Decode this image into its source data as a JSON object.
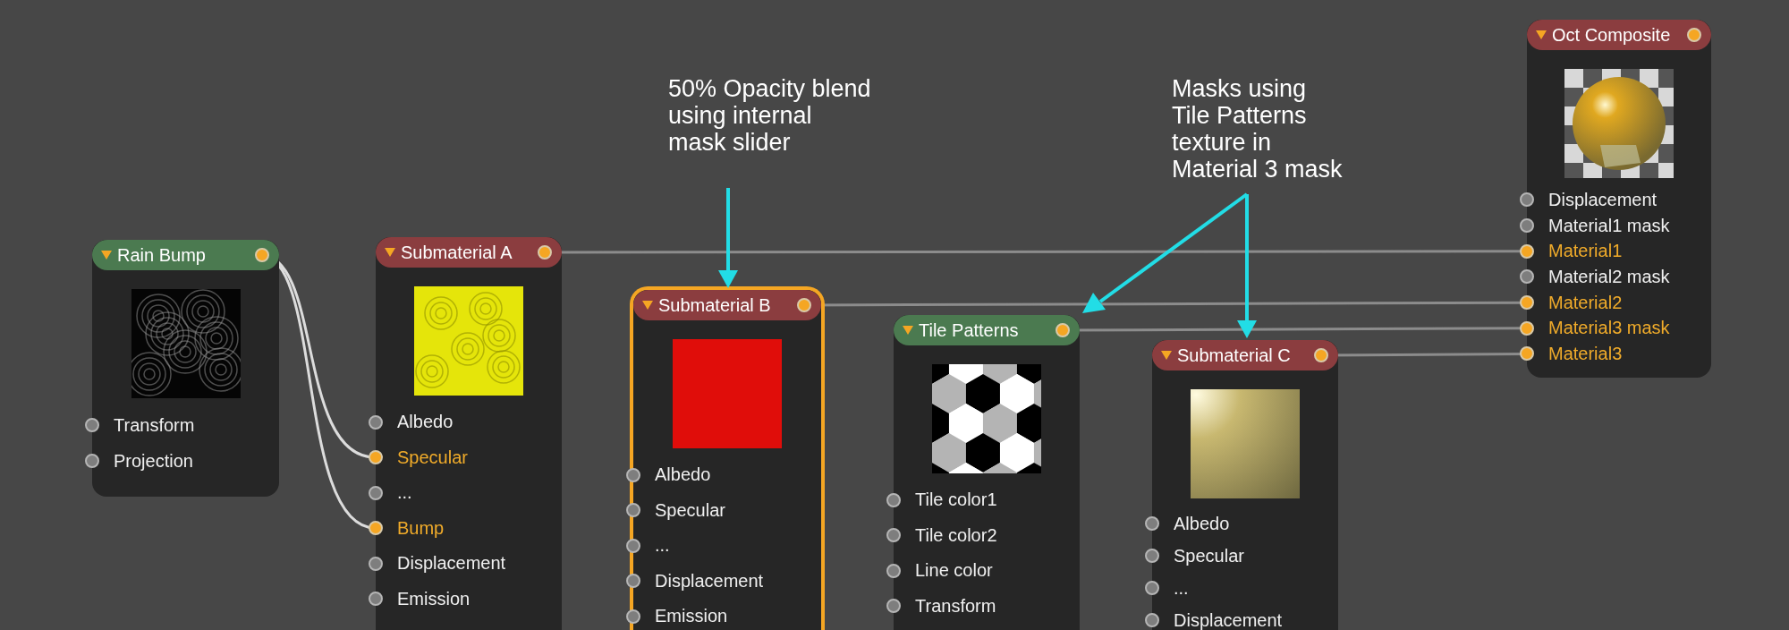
{
  "nodes": [
    {
      "title": "Rain Bump",
      "kind": "texture",
      "selected": false,
      "ports": [
        {
          "label": "Transform",
          "connected": false
        },
        {
          "label": "Projection",
          "connected": false
        }
      ]
    },
    {
      "title": "Submaterial A",
      "kind": "material",
      "selected": false,
      "ports": [
        {
          "label": "Albedo",
          "connected": false
        },
        {
          "label": "Specular",
          "connected": true
        },
        {
          "label": "...",
          "connected": false
        },
        {
          "label": "Bump",
          "connected": true
        },
        {
          "label": "Displacement",
          "connected": false
        },
        {
          "label": "Emission",
          "connected": false
        }
      ]
    },
    {
      "title": "Submaterial B",
      "kind": "material",
      "selected": true,
      "ports": [
        {
          "label": "Albedo",
          "connected": false
        },
        {
          "label": "Specular",
          "connected": false
        },
        {
          "label": "...",
          "connected": false
        },
        {
          "label": "Displacement",
          "connected": false
        },
        {
          "label": "Emission",
          "connected": false
        }
      ]
    },
    {
      "title": "Tile Patterns",
      "kind": "texture",
      "selected": false,
      "ports": [
        {
          "label": "Tile color1",
          "connected": false
        },
        {
          "label": "Tile color2",
          "connected": false
        },
        {
          "label": "Line color",
          "connected": false
        },
        {
          "label": "Transform",
          "connected": false
        }
      ]
    },
    {
      "title": "Submaterial C",
      "kind": "material",
      "selected": false,
      "ports": [
        {
          "label": "Albedo",
          "connected": false
        },
        {
          "label": "Specular",
          "connected": false
        },
        {
          "label": "...",
          "connected": false
        },
        {
          "label": "Displacement",
          "connected": false
        }
      ]
    },
    {
      "title": "Oct Composite",
      "kind": "material",
      "selected": false,
      "ports": [
        {
          "label": "Displacement",
          "connected": false
        },
        {
          "label": "Material1 mask",
          "connected": false
        },
        {
          "label": "Material1",
          "connected": true
        },
        {
          "label": "Material2 mask",
          "connected": false
        },
        {
          "label": "Material2",
          "connected": true
        },
        {
          "label": "Material3 mask",
          "connected": true
        },
        {
          "label": "Material3",
          "connected": true
        }
      ]
    }
  ],
  "annotations": [
    {
      "lines": [
        "50% Opacity blend",
        "using internal",
        "mask slider"
      ]
    },
    {
      "lines": [
        "Masks using",
        "Tile Patterns",
        "texture in",
        "Material 3 mask"
      ]
    }
  ]
}
